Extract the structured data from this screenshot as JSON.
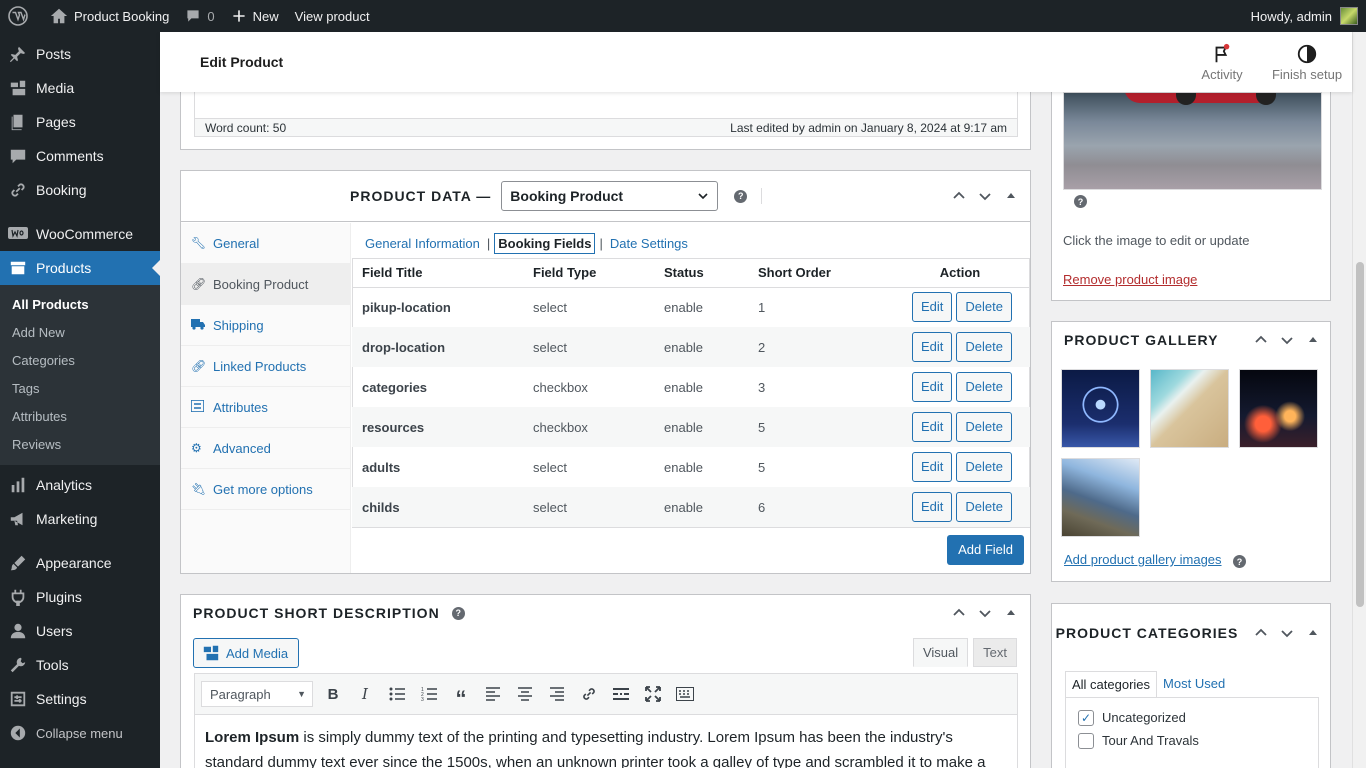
{
  "adminbar": {
    "site_name": "Product Booking",
    "comments_count": "0",
    "new_label": "New",
    "view_label": "View product",
    "greeting": "Howdy, admin"
  },
  "sidebar": {
    "items": [
      {
        "label": "Posts",
        "icon": "pin-icon"
      },
      {
        "label": "Media",
        "icon": "media-icon"
      },
      {
        "label": "Pages",
        "icon": "pages-icon"
      },
      {
        "label": "Comments",
        "icon": "comment-icon"
      },
      {
        "label": "Booking",
        "icon": "link-icon"
      },
      {
        "label": "WooCommerce",
        "icon": "woo-icon"
      },
      {
        "label": "Products",
        "icon": "archive-icon"
      },
      {
        "label": "Analytics",
        "icon": "chart-icon"
      },
      {
        "label": "Marketing",
        "icon": "megaphone-icon"
      },
      {
        "label": "Appearance",
        "icon": "brush-icon"
      },
      {
        "label": "Plugins",
        "icon": "plugin-icon"
      },
      {
        "label": "Users",
        "icon": "user-icon"
      },
      {
        "label": "Tools",
        "icon": "wrench-icon"
      },
      {
        "label": "Settings",
        "icon": "settings-icon"
      },
      {
        "label": "Collapse menu",
        "icon": "collapse-icon"
      }
    ],
    "submenu": [
      "All Products",
      "Add New",
      "Categories",
      "Tags",
      "Attributes",
      "Reviews"
    ]
  },
  "header": {
    "title": "Edit Product",
    "activity_label": "Activity",
    "finish_label": "Finish setup"
  },
  "editor": {
    "word_count": "Word count: 50",
    "last_edited": "Last edited by admin on January 8, 2024 at 9:17 am"
  },
  "product_data": {
    "label": "PRODUCT DATA —",
    "type_selected": "Booking Product",
    "tabs": [
      "General",
      "Booking Product",
      "Shipping",
      "Linked Products",
      "Attributes",
      "Advanced",
      "Get more options"
    ],
    "subtabs": [
      "General Information",
      "Booking Fields",
      "Date Settings"
    ],
    "columns": [
      "Field Title",
      "Field Type",
      "Status",
      "Short Order",
      "Action"
    ],
    "rows": [
      {
        "title": "pikup-location",
        "type": "select",
        "status": "enable",
        "order": "1"
      },
      {
        "title": "drop-location",
        "type": "select",
        "status": "enable",
        "order": "2"
      },
      {
        "title": "categories",
        "type": "checkbox",
        "status": "enable",
        "order": "3"
      },
      {
        "title": "resources",
        "type": "checkbox",
        "status": "enable",
        "order": "5"
      },
      {
        "title": "adults",
        "type": "select",
        "status": "enable",
        "order": "5"
      },
      {
        "title": "childs",
        "type": "select",
        "status": "enable",
        "order": "6"
      }
    ],
    "edit_label": "Edit",
    "delete_label": "Delete",
    "add_field_label": "Add Field"
  },
  "short_desc": {
    "title": "PRODUCT SHORT DESCRIPTION",
    "add_media": "Add Media",
    "visual_tab": "Visual",
    "text_tab": "Text",
    "format_select": "Paragraph",
    "content_bold": "Lorem Ipsum",
    "content_rest": " is simply dummy text of the printing and typesetting industry. Lorem Ipsum has been the industry's standard dummy text ever since the 1500s, when an unknown printer took a galley of type and scrambled it to make a"
  },
  "product_image": {
    "hint": "Click the image to edit or update",
    "remove_label": "Remove product image"
  },
  "gallery": {
    "title": "PRODUCT GALLERY",
    "add_label": "Add product gallery images"
  },
  "categories": {
    "title": "PRODUCT CATEGORIES",
    "tab_all": "All categories",
    "tab_used": "Most Used",
    "items": [
      {
        "label": "Uncategorized",
        "checked": true
      },
      {
        "label": "Tour And Travals",
        "checked": false
      }
    ]
  },
  "colors": {
    "admin_dark": "#1d2327",
    "accent": "#2271b1",
    "danger": "#b32d2e"
  }
}
